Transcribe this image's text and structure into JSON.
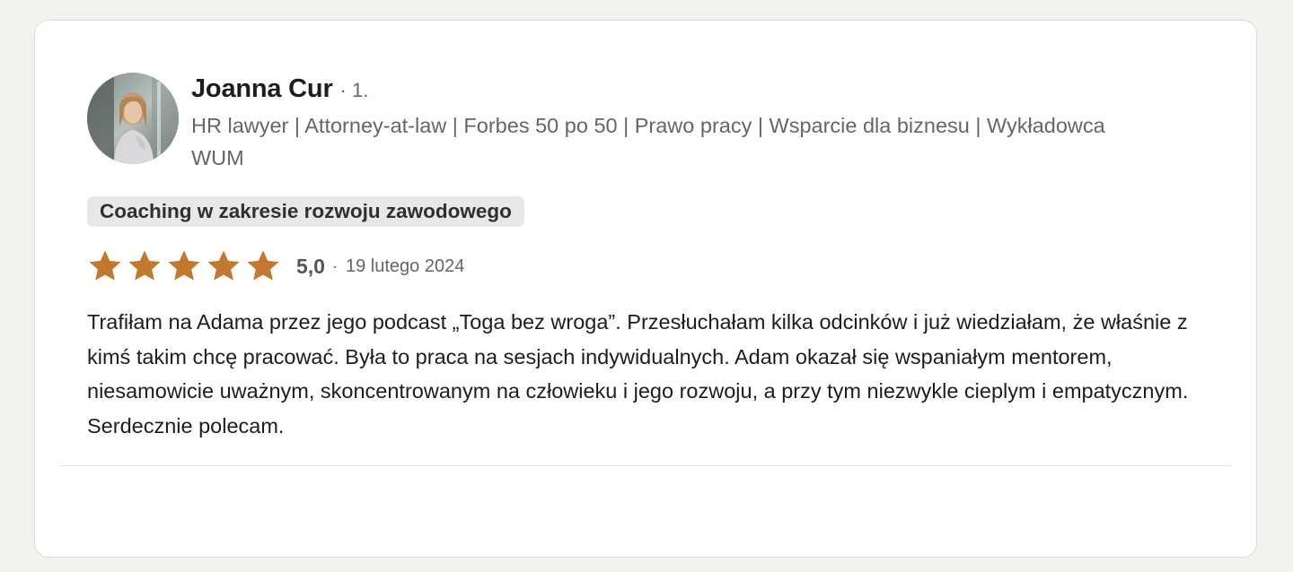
{
  "review": {
    "author": {
      "name": "Joanna Cur",
      "degree": "· 1.",
      "headline": "HR lawyer | Attorney-at-law | Forbes 50 po 50 | Prawo pracy | Wsparcie dla biznesu | Wykładowca WUM",
      "avatar": "profile-photo"
    },
    "service_tag": "Coaching w zakresie rozwoju zawodowego",
    "rating": {
      "stars": 5,
      "max_stars": 5,
      "score": "5,0",
      "separator": "·",
      "date": "19 lutego 2024",
      "star_color": "#c2792e"
    },
    "text": "Trafiłam na Adama przez jego podcast „Toga bez wroga”. Przesłuchałam kilka odcinków i już wiedziałam, że właśnie z kimś takim chcę pracować. Była to praca na sesjach indywidualnych. Adam okazał się wspaniałym mentorem, niesamowicie uważnym, skoncentrowanym na człowieku i jego rozwoju, a przy tym niezwykle cieplym i empatycznym. Serdecznie polecam."
  }
}
